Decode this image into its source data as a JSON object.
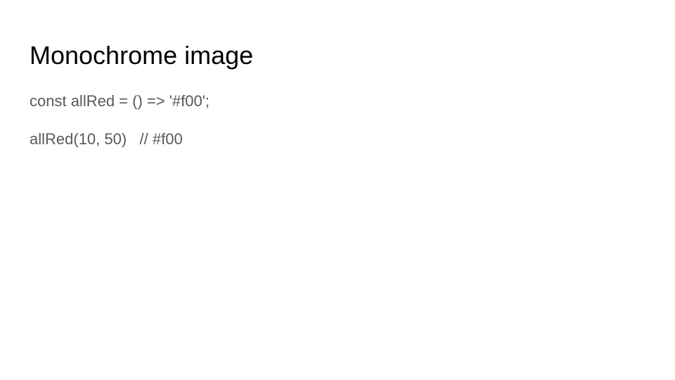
{
  "slide": {
    "title": "Monochrome image",
    "body_lines": [
      "const allRed = () => '#f00';",
      "allRed(10, 50)   // #f00"
    ]
  },
  "colors": {
    "background": "#ffffff",
    "title_text": "#000000",
    "body_text": "#595959"
  }
}
